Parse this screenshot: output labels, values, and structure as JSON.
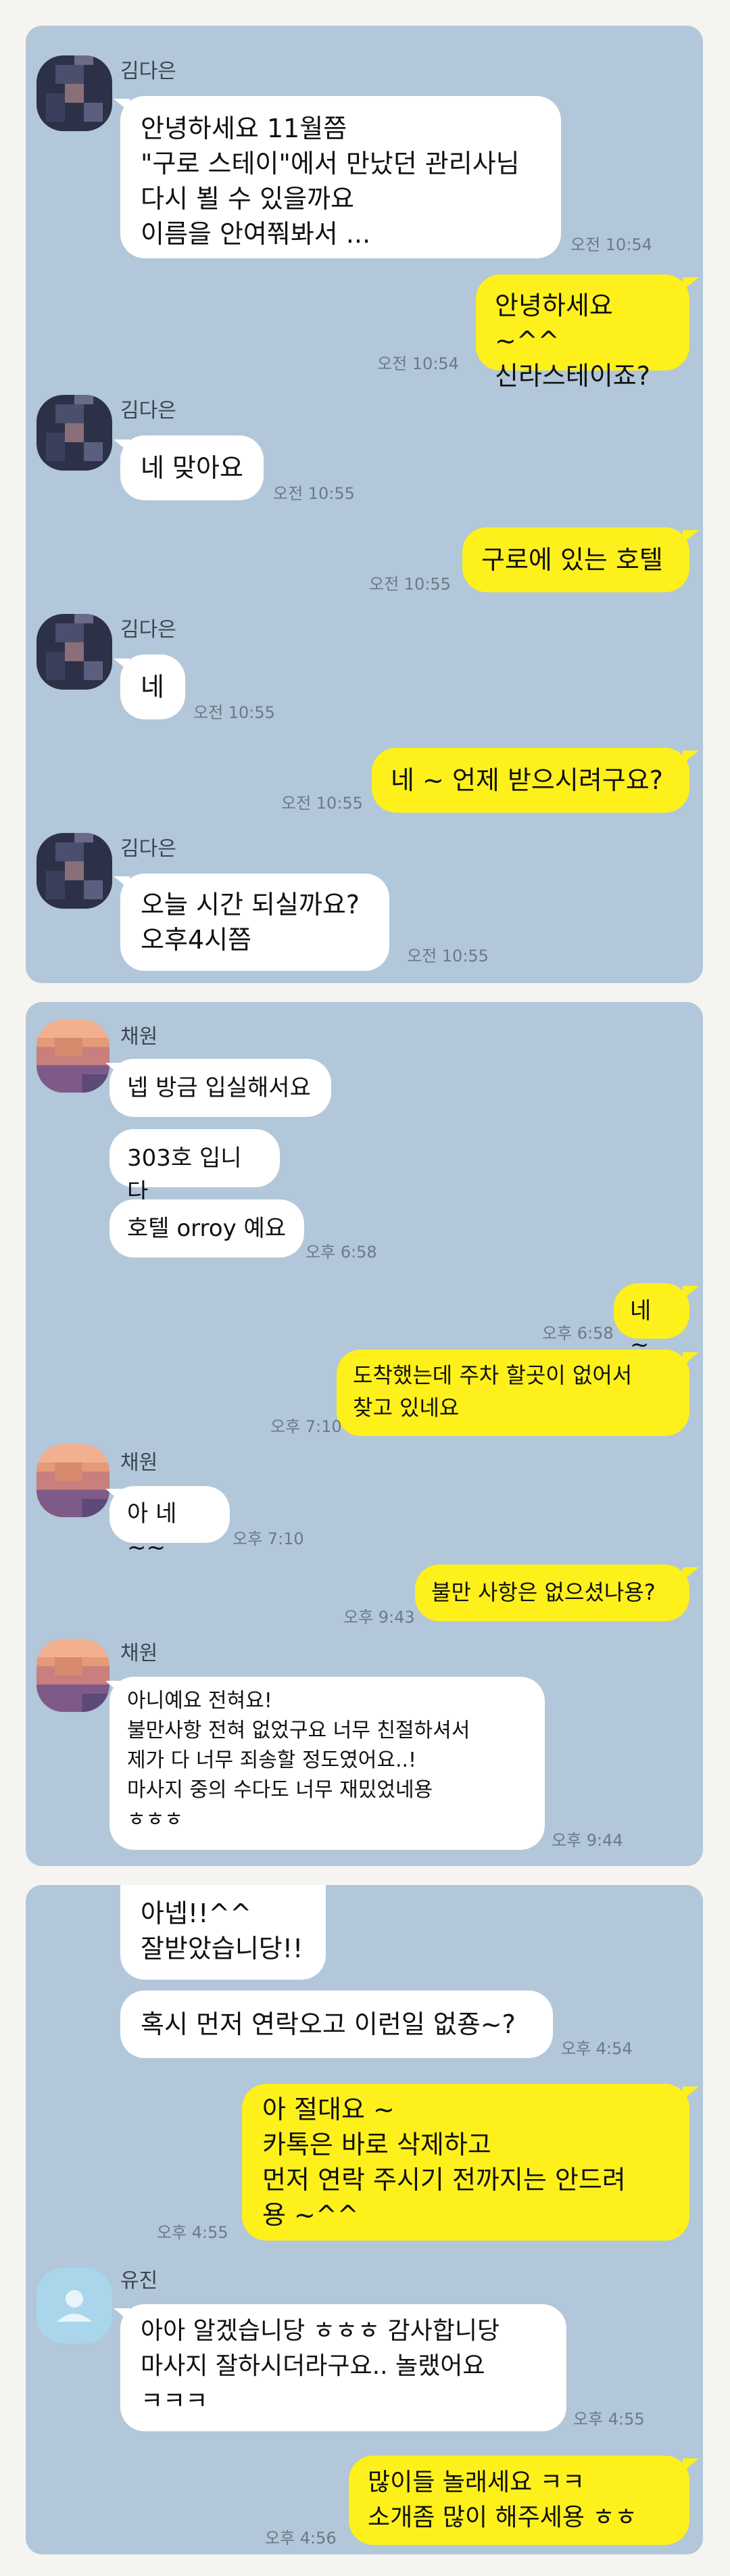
{
  "panel1": {
    "contact": "김다은",
    "messages": [
      {
        "text": "안녕하세요 11월쯤\n\"구로 스테이\"에서 만났던 관리사님\n다시 뵐 수 있을까요\n이름을 안여쭤봐서 ...",
        "time": "오전 10:54"
      },
      {
        "text": "안녕하세요 ~^^\n신라스테이죠?",
        "time": "오전 10:54"
      },
      {
        "text": "네 맞아요",
        "time": "오전 10:55"
      },
      {
        "text": "구로에 있는 호텔",
        "time": "오전 10:55"
      },
      {
        "text": "네",
        "time": "오전 10:55"
      },
      {
        "text": "네 ~ 언제 받으시려구요?",
        "time": "오전 10:55"
      },
      {
        "text": "오늘  시간 되실까요?\n오후4시쯤",
        "time": "오전 10:55"
      }
    ]
  },
  "panel2": {
    "contact": "채원",
    "messages": [
      {
        "text": "넵 방금 입실해서요"
      },
      {
        "text": "303호 입니다"
      },
      {
        "text": "호텔 orroy 예요",
        "time": "오후 6:58"
      },
      {
        "text": "네 ~",
        "time": "오후 6:58"
      },
      {
        "text": "도착했는데  주차 할곳이 없어서\n찾고 있네요",
        "time": "오후 7:10"
      },
      {
        "text": "아 네~~",
        "time": "오후 7:10"
      },
      {
        "text": "불만 사항은 없으셨나용?",
        "time": "오후 9:43"
      },
      {
        "text": "아니예요 전혀요!\n불만사항 전혀 없었구요 너무 친절하셔서\n제가 다 너무 죄송할 정도였어요..!\n마사지 중의 수다도 너무 재밌었네용\nㅎㅎㅎ",
        "time": "오후 9:44"
      }
    ]
  },
  "panel3": {
    "contact": "유진",
    "messages": [
      {
        "text": "아넵!!^^\n잘받았습니당!!"
      },
      {
        "text": "혹시 먼저 연락오고 이런일 없죵~?",
        "time": "오후 4:54"
      },
      {
        "text": "아 절대요 ~\n카톡은 바로 삭제하고\n먼저 연락 주시기 전까지는 안드려\n용 ~^^",
        "time": "오후 4:55"
      },
      {
        "text": "아아 알겠습니당 ㅎㅎㅎ 감사합니당\n마사지 잘하시더라구요.. 놀랬어요\nㅋㅋㅋ",
        "time": "오후 4:55"
      },
      {
        "text": "많이들 놀래세요 ㅋㅋ\n소개좀 많이 해주세용 ㅎㅎ",
        "time": "오후 4:56"
      }
    ]
  }
}
